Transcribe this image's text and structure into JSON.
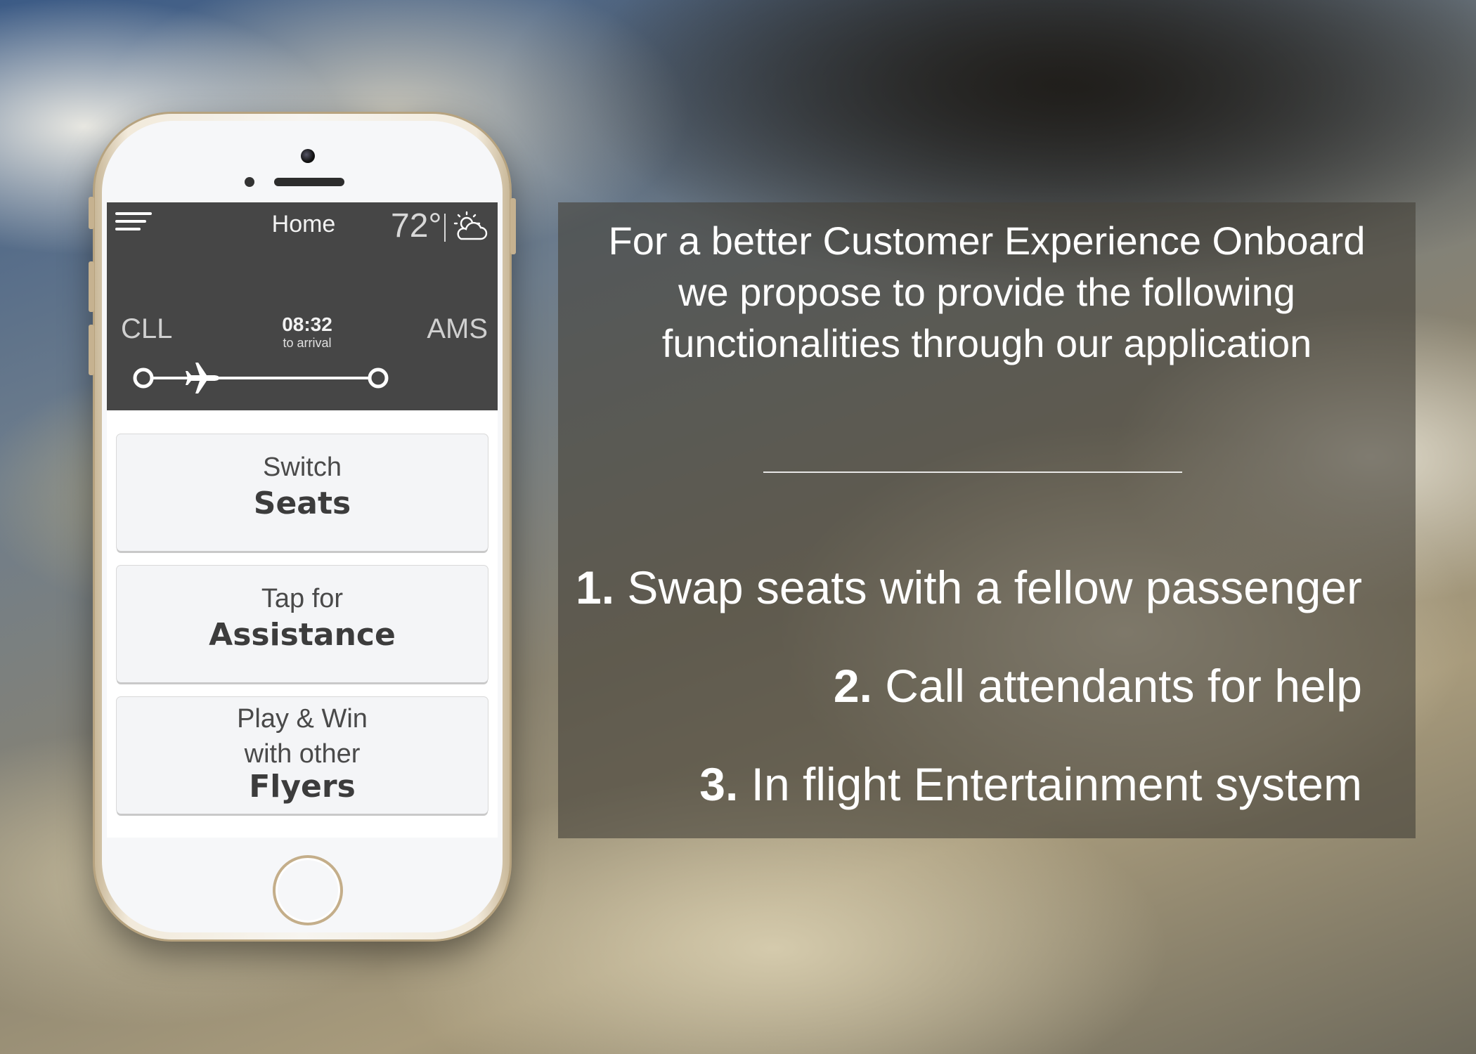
{
  "app": {
    "header": {
      "title": "Home",
      "temperature": "72°",
      "weather_icon": "partly-cloudy-sun-icon",
      "menu_icon": "hamburger-menu-icon"
    },
    "flight": {
      "origin": "CLL",
      "destination": "AMS",
      "time_remaining": "08:32",
      "time_label": "to arrival",
      "progress": 0.2
    },
    "cards": [
      {
        "line1": "Switch",
        "line2": "",
        "strong": "Seats"
      },
      {
        "line1": "Tap for",
        "line2": "",
        "strong": "Assistance"
      },
      {
        "line1": "Play & Win",
        "line2": "with other",
        "strong": "Flyers"
      }
    ]
  },
  "panel": {
    "intro_lines": [
      "For a better Customer Experience Onboard",
      "we propose to provide the following",
      "functionalities through our application"
    ],
    "features": [
      {
        "number": "1.",
        "text": " Swap seats with a fellow passenger"
      },
      {
        "number": "2.",
        "text": " Call attendants for help"
      },
      {
        "number": "3.",
        "text": " In flight Entertainment system"
      }
    ]
  },
  "colors": {
    "header_bg": "#464646",
    "card_bg": "#f4f5f7",
    "panel_bg": "rgba(70,66,58,0.62)",
    "phone_frame": "#c4ae8a"
  }
}
